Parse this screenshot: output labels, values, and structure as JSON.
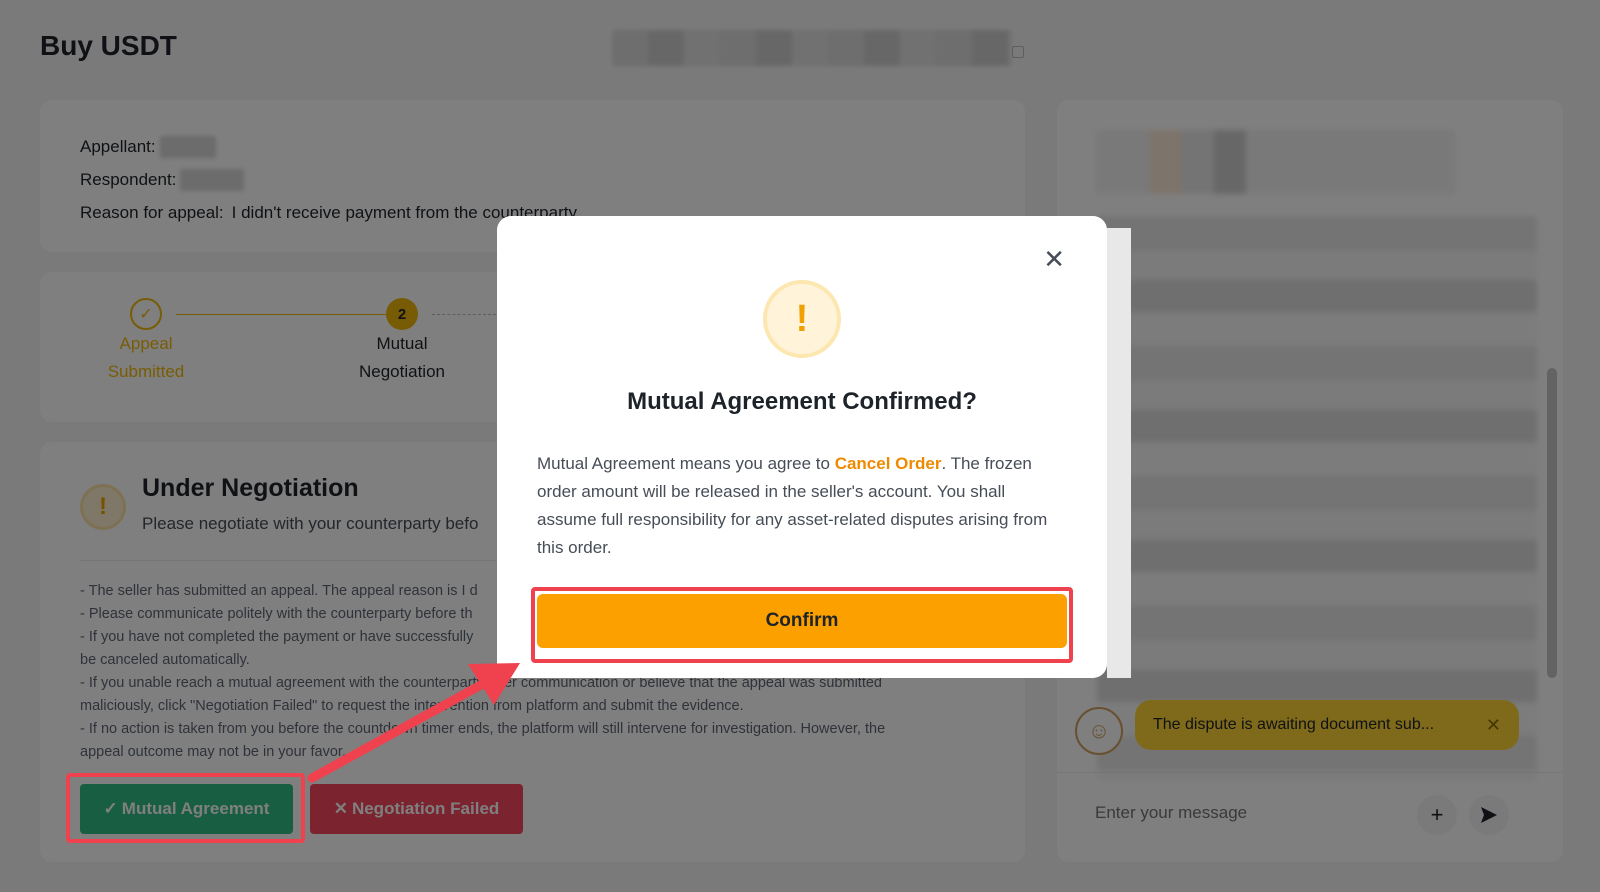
{
  "page": {
    "title": "Buy USDT"
  },
  "appeal": {
    "appellant_label": "Appellant:",
    "respondent_label": "Respondent:",
    "reason_label": "Reason for appeal:",
    "reason_value": "I didn't receive payment from the counterparty"
  },
  "steps": [
    {
      "number": "1",
      "label_line1": "Appeal",
      "label_line2": "Submitted",
      "state": "done"
    },
    {
      "number": "2",
      "label_line1": "Mutual",
      "label_line2": "Negotiation",
      "state": "current"
    }
  ],
  "negotiation": {
    "icon": "exclamation-icon",
    "title": "Under Negotiation",
    "subtitle": "Please negotiate with your counterparty befo",
    "notes": [
      "- The seller has submitted an appeal. The appeal reason is I d",
      "- Please communicate politely with the counterparty before th",
      "- If you have not completed the payment or have successfully",
      "be canceled automatically.",
      "- If you unable reach a mutual agreement with the counterparty after communication or believe that the appeal was submitted",
      "maliciously, click \"Negotiation Failed\" to request the intervention from platform and submit the evidence.",
      "- If no action is taken from you before the countdown timer ends, the platform will still intervene for investigation. However, the",
      "appeal outcome may not be in your favor."
    ],
    "mutual_button": "Mutual Agreement",
    "failed_button": "Negotiation Failed"
  },
  "chat": {
    "bot_message": "The dispute is awaiting document sub...",
    "input_placeholder": "Enter your message"
  },
  "modal": {
    "title": "Mutual Agreement Confirmed?",
    "text_before": "Mutual Agreement means you agree to ",
    "text_highlight": "Cancel Order",
    "text_after": ". The frozen order amount will be released in the seller's account. You shall assume full responsibility for any asset-related disputes arising from this order.",
    "confirm_label": "Confirm",
    "icon": "warning-icon"
  },
  "colors": {
    "accent": "#fca000",
    "success": "#2ebd85",
    "danger": "#f6465d",
    "highlight_box": "#f0414e"
  }
}
